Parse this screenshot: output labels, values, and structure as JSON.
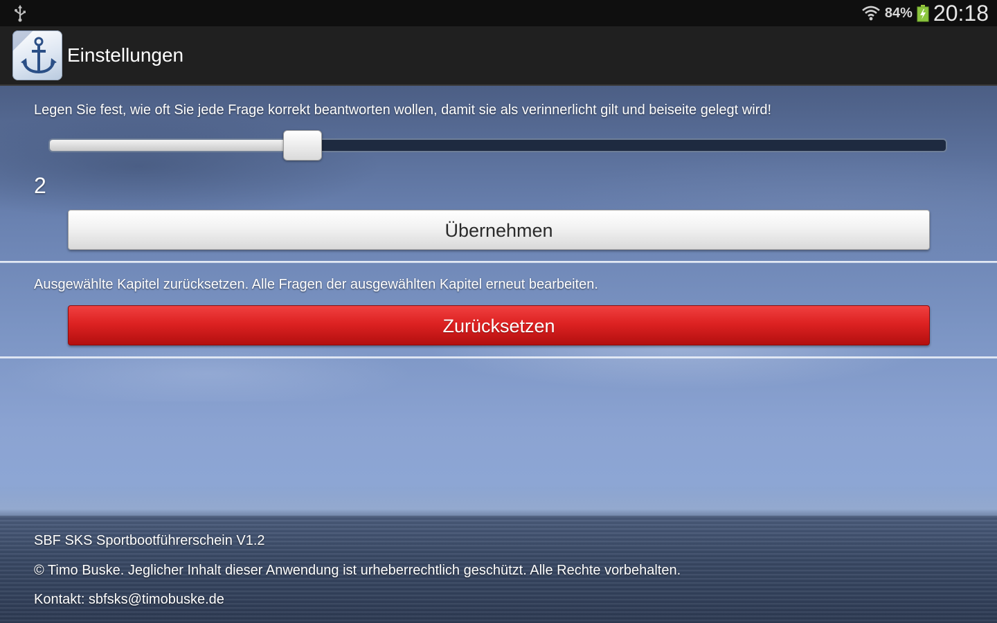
{
  "status_bar": {
    "battery_percent": "84%",
    "time": "20:18",
    "icons": [
      "usb-icon",
      "wifi-icon",
      "battery-charging-icon"
    ]
  },
  "action_bar": {
    "title": "Einstellungen",
    "app_icon": "anchor-icon"
  },
  "repeat_section": {
    "description": "Legen Sie fest, wie oft Sie jede Frage korrekt beantworten wollen, damit sie als verinnerlicht gilt und beiseite gelegt wird!",
    "slider_fraction": 0.283,
    "value": "2",
    "apply_label": "Übernehmen"
  },
  "reset_section": {
    "description": "Ausgewählte Kapitel zurücksetzen. Alle Fragen der ausgewählten Kapitel erneut bearbeiten.",
    "reset_label": "Zurücksetzen",
    "reset_color": "#d92121"
  },
  "footer": {
    "version": "SBF SKS Sportbootführerschein  V1.2",
    "copyright": "© Timo Buske. Jeglicher Inhalt dieser Anwendung ist urheberrechtlich geschützt. Alle Rechte vorbehalten.",
    "contact": "Kontakt: sbfsks@timobuske.de"
  }
}
